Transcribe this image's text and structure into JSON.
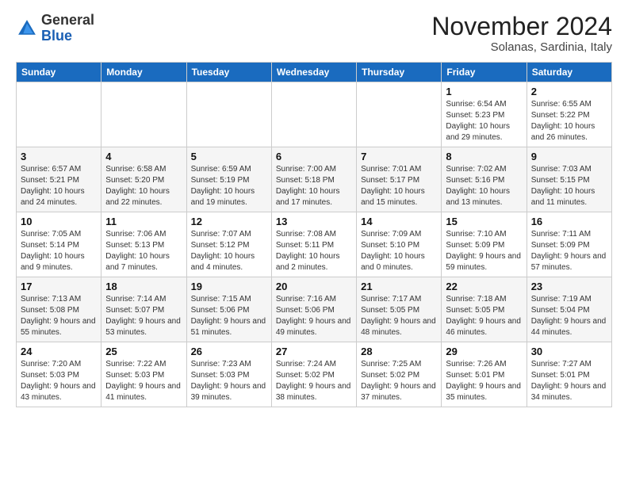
{
  "logo": {
    "general": "General",
    "blue": "Blue"
  },
  "header": {
    "month_year": "November 2024",
    "location": "Solanas, Sardinia, Italy"
  },
  "weekdays": [
    "Sunday",
    "Monday",
    "Tuesday",
    "Wednesday",
    "Thursday",
    "Friday",
    "Saturday"
  ],
  "weeks": [
    [
      {
        "day": "",
        "info": ""
      },
      {
        "day": "",
        "info": ""
      },
      {
        "day": "",
        "info": ""
      },
      {
        "day": "",
        "info": ""
      },
      {
        "day": "",
        "info": ""
      },
      {
        "day": "1",
        "info": "Sunrise: 6:54 AM\nSunset: 5:23 PM\nDaylight: 10 hours and 29 minutes."
      },
      {
        "day": "2",
        "info": "Sunrise: 6:55 AM\nSunset: 5:22 PM\nDaylight: 10 hours and 26 minutes."
      }
    ],
    [
      {
        "day": "3",
        "info": "Sunrise: 6:57 AM\nSunset: 5:21 PM\nDaylight: 10 hours and 24 minutes."
      },
      {
        "day": "4",
        "info": "Sunrise: 6:58 AM\nSunset: 5:20 PM\nDaylight: 10 hours and 22 minutes."
      },
      {
        "day": "5",
        "info": "Sunrise: 6:59 AM\nSunset: 5:19 PM\nDaylight: 10 hours and 19 minutes."
      },
      {
        "day": "6",
        "info": "Sunrise: 7:00 AM\nSunset: 5:18 PM\nDaylight: 10 hours and 17 minutes."
      },
      {
        "day": "7",
        "info": "Sunrise: 7:01 AM\nSunset: 5:17 PM\nDaylight: 10 hours and 15 minutes."
      },
      {
        "day": "8",
        "info": "Sunrise: 7:02 AM\nSunset: 5:16 PM\nDaylight: 10 hours and 13 minutes."
      },
      {
        "day": "9",
        "info": "Sunrise: 7:03 AM\nSunset: 5:15 PM\nDaylight: 10 hours and 11 minutes."
      }
    ],
    [
      {
        "day": "10",
        "info": "Sunrise: 7:05 AM\nSunset: 5:14 PM\nDaylight: 10 hours and 9 minutes."
      },
      {
        "day": "11",
        "info": "Sunrise: 7:06 AM\nSunset: 5:13 PM\nDaylight: 10 hours and 7 minutes."
      },
      {
        "day": "12",
        "info": "Sunrise: 7:07 AM\nSunset: 5:12 PM\nDaylight: 10 hours and 4 minutes."
      },
      {
        "day": "13",
        "info": "Sunrise: 7:08 AM\nSunset: 5:11 PM\nDaylight: 10 hours and 2 minutes."
      },
      {
        "day": "14",
        "info": "Sunrise: 7:09 AM\nSunset: 5:10 PM\nDaylight: 10 hours and 0 minutes."
      },
      {
        "day": "15",
        "info": "Sunrise: 7:10 AM\nSunset: 5:09 PM\nDaylight: 9 hours and 59 minutes."
      },
      {
        "day": "16",
        "info": "Sunrise: 7:11 AM\nSunset: 5:09 PM\nDaylight: 9 hours and 57 minutes."
      }
    ],
    [
      {
        "day": "17",
        "info": "Sunrise: 7:13 AM\nSunset: 5:08 PM\nDaylight: 9 hours and 55 minutes."
      },
      {
        "day": "18",
        "info": "Sunrise: 7:14 AM\nSunset: 5:07 PM\nDaylight: 9 hours and 53 minutes."
      },
      {
        "day": "19",
        "info": "Sunrise: 7:15 AM\nSunset: 5:06 PM\nDaylight: 9 hours and 51 minutes."
      },
      {
        "day": "20",
        "info": "Sunrise: 7:16 AM\nSunset: 5:06 PM\nDaylight: 9 hours and 49 minutes."
      },
      {
        "day": "21",
        "info": "Sunrise: 7:17 AM\nSunset: 5:05 PM\nDaylight: 9 hours and 48 minutes."
      },
      {
        "day": "22",
        "info": "Sunrise: 7:18 AM\nSunset: 5:05 PM\nDaylight: 9 hours and 46 minutes."
      },
      {
        "day": "23",
        "info": "Sunrise: 7:19 AM\nSunset: 5:04 PM\nDaylight: 9 hours and 44 minutes."
      }
    ],
    [
      {
        "day": "24",
        "info": "Sunrise: 7:20 AM\nSunset: 5:03 PM\nDaylight: 9 hours and 43 minutes."
      },
      {
        "day": "25",
        "info": "Sunrise: 7:22 AM\nSunset: 5:03 PM\nDaylight: 9 hours and 41 minutes."
      },
      {
        "day": "26",
        "info": "Sunrise: 7:23 AM\nSunset: 5:03 PM\nDaylight: 9 hours and 39 minutes."
      },
      {
        "day": "27",
        "info": "Sunrise: 7:24 AM\nSunset: 5:02 PM\nDaylight: 9 hours and 38 minutes."
      },
      {
        "day": "28",
        "info": "Sunrise: 7:25 AM\nSunset: 5:02 PM\nDaylight: 9 hours and 37 minutes."
      },
      {
        "day": "29",
        "info": "Sunrise: 7:26 AM\nSunset: 5:01 PM\nDaylight: 9 hours and 35 minutes."
      },
      {
        "day": "30",
        "info": "Sunrise: 7:27 AM\nSunset: 5:01 PM\nDaylight: 9 hours and 34 minutes."
      }
    ]
  ]
}
